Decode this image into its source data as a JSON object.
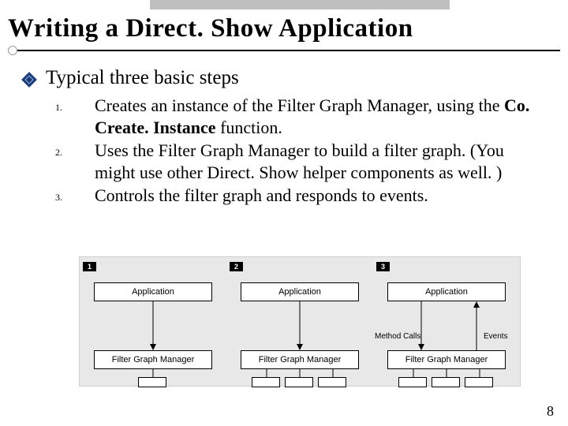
{
  "title": "Writing a Direct. Show Application",
  "subtitle": "Typical three basic steps",
  "steps": [
    {
      "num": "1.",
      "text_pre": "Creates an instance of the Filter Graph Manager, using the ",
      "bold": "Co. Create. Instance",
      "text_post": " function."
    },
    {
      "num": "2.",
      "text_pre": "Uses the Filter Graph Manager to build a filter graph. (You might use other Direct. Show helper components as well. )",
      "bold": "",
      "text_post": ""
    },
    {
      "num": "3.",
      "text_pre": "Controls the filter graph and responds to events.",
      "bold": "",
      "text_post": ""
    }
  ],
  "diagram": {
    "tags": [
      "1",
      "2",
      "3"
    ],
    "app_label": "Application",
    "fgm_label": "Filter Graph Manager",
    "method_calls": "Method Calls",
    "events": "Events"
  },
  "page_number": "8"
}
